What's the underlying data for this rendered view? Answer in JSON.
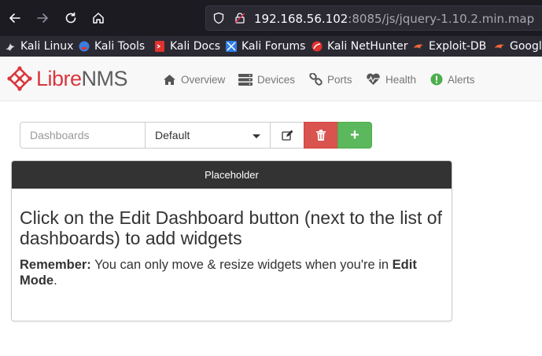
{
  "browser": {
    "url_host": "192.168.56.102",
    "url_rest": ":8085/js/jquery-1.10.2.min.map",
    "bookmarks": [
      {
        "label": "Kali Linux",
        "icon": "kali-dragon-icon",
        "color": "#d9d9d9"
      },
      {
        "label": "Kali Tools",
        "icon": "kali-tools-icon",
        "color": "#3b7ddd"
      },
      {
        "label": "Kali Docs",
        "icon": "kali-docs-icon",
        "color": "#e0322f"
      },
      {
        "label": "Kali Forums",
        "icon": "kali-forums-icon",
        "color": "#2f7de1"
      },
      {
        "label": "Kali NetHunter",
        "icon": "nethunter-icon",
        "color": "#e0322f"
      },
      {
        "label": "Exploit-DB",
        "icon": "exploit-db-icon",
        "color": "#f0683a"
      },
      {
        "label": "Googl",
        "icon": "google-hacking-icon",
        "color": "#f0683a"
      }
    ]
  },
  "app": {
    "logo_libre": "Libre",
    "logo_nms": "NMS",
    "brand_color": "#d9373d",
    "nav": [
      {
        "label": "Overview",
        "icon": "home-icon"
      },
      {
        "label": "Devices",
        "icon": "server-icon"
      },
      {
        "label": "Ports",
        "icon": "link-icon"
      },
      {
        "label": "Health",
        "icon": "heartbeat-icon"
      },
      {
        "label": "Alerts",
        "icon": "exclamation-circle-icon"
      }
    ]
  },
  "dashboard": {
    "input_placeholder": "Dashboards",
    "selected": "Default",
    "add_label": "+"
  },
  "widget": {
    "title": "Placeholder",
    "heading": "Click on the Edit Dashboard button (next to the list of dashboards) to add widgets",
    "remember_label": "Remember:",
    "remember_text": " You can only move & resize widgets when you're in ",
    "edit_mode": "Edit Mode",
    "period": "."
  }
}
